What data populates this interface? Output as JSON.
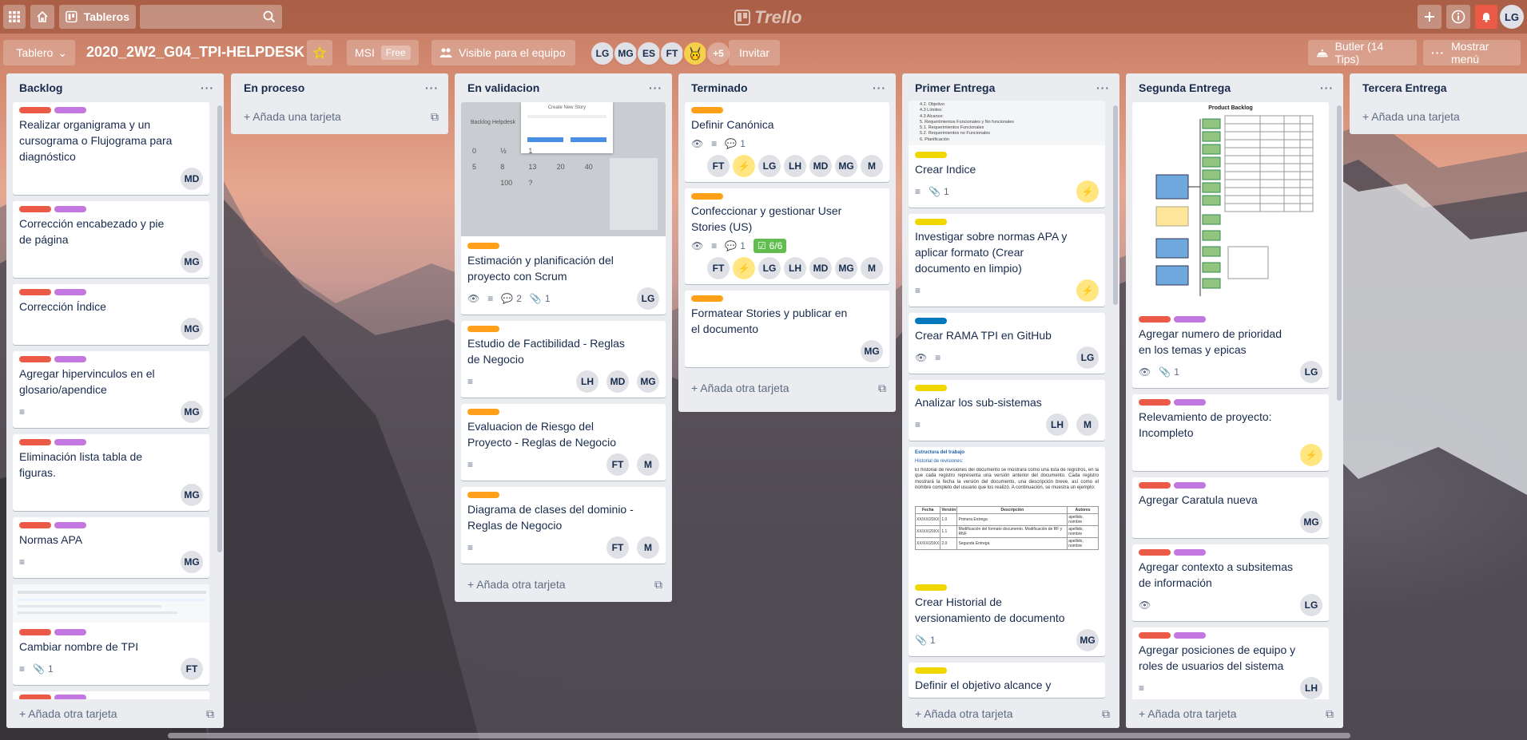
{
  "header": {
    "boards_label": "Tableros",
    "search_placeholder": "",
    "logo_text": "Trello",
    "user_initials": "LG"
  },
  "board": {
    "view_label": "Tablero",
    "title": "2020_2W2_G04_TPI-HELPDESK",
    "team": "MSI",
    "team_plan": "Free",
    "visibility": "Visible para el equipo",
    "members": [
      "LG",
      "MG",
      "ES",
      "FT"
    ],
    "more_members": "+5",
    "invite_label": "Invitar",
    "butler_label": "Butler (14 Tips)",
    "menu_label": "Mostrar menú"
  },
  "lists": [
    {
      "name": "Backlog",
      "add_label": "Añada otra tarjeta",
      "cards": [
        {
          "title": "Realizar organigrama y un cursograma o Flujograma para diagnóstico",
          "member": "MD"
        },
        {
          "title": "Corrección encabezado y pie de página",
          "member": "MG"
        },
        {
          "title": "Corrección Índice",
          "member": "MG"
        },
        {
          "title": "Agregar hipervinculos en el glosario/apendice",
          "member": "MG"
        },
        {
          "title": "Eliminación lista tabla de figuras.",
          "member": "MG"
        },
        {
          "title": "Normas APA",
          "member": "MG"
        },
        {
          "title": "Cambiar nombre de TPI",
          "member": "FT",
          "attachments": "1"
        }
      ]
    },
    {
      "name": "En proceso",
      "add_label": "Añada una tarjeta"
    },
    {
      "name": "En validacion",
      "add_label": "Añada otra tarjeta",
      "cover_title": "Create New Story",
      "cover_heading": "Backlog Helpdesk",
      "cover_numbers": [
        "0",
        "½",
        "1",
        "5",
        "8",
        "13",
        "20",
        "40",
        "100",
        "?"
      ],
      "cards": [
        {
          "title": "Estimación y planificación del proyecto con Scrum",
          "comments": "2",
          "attachments": "1",
          "members": [
            "LG"
          ]
        },
        {
          "title": "Estudio de Factibilidad - Reglas de Negocio",
          "members": [
            "LH",
            "MD",
            "MG"
          ]
        },
        {
          "title": "Evaluacion de Riesgo del Proyecto - Reglas de Negocio",
          "members": [
            "FT",
            "M"
          ]
        },
        {
          "title": "Diagrama de clases del dominio - Reglas de Negocio",
          "members": [
            "FT",
            "M"
          ]
        }
      ]
    },
    {
      "name": "Terminado",
      "add_label": "Añada otra tarjeta",
      "cards": [
        {
          "title": "Definir Canónica",
          "comments": "1",
          "members": [
            "FT",
            "LG",
            "LH",
            "MD",
            "MG",
            "M"
          ]
        },
        {
          "title": "Confeccionar y gestionar User Stories (US)",
          "comments": "1",
          "checklist": "6/6",
          "members": [
            "FT",
            "LG",
            "LH",
            "MD",
            "MG",
            "M"
          ]
        },
        {
          "title": "Formatear Stories y publicar en el documento",
          "members": [
            "MG"
          ]
        }
      ]
    },
    {
      "name": "Primer Entrega",
      "add_label": "Añada otra tarjeta",
      "cover_toc": [
        "4.2. Objetivo",
        "4.3 Límites:",
        "4.3 Alcance:",
        "5. Requerimientos Funcionales y No funcionales",
        "5.1. Requerimientos Funcionales",
        "5.2. Requerimientos no Funcionales",
        "6. Planificación"
      ],
      "doc_heading": "Estructura del trabajo",
      "doc_sub": "Historial de revisiones:",
      "doc_para": "El historial de revisiones del documento se mostrará como una lista de registros, en la que cada registro representa una versión anterior del documento. Cada registro mostrará la fecha la versión del documento, una descripción breve, así como el nombre completo del usuario que los realizó. A continuación, se muestra un ejemplo:",
      "doc_table_head": [
        "Fecha",
        "Versión",
        "Descripción",
        "Autores"
      ],
      "doc_table_rows": [
        [
          "XX/XX/20XX",
          "1.0",
          "Primera Entrega",
          "apellido, nombre"
        ],
        [
          "XX/XX/20XX",
          "1.1",
          "Modificación del formato documento. Modificación de RF y RNF.",
          "apellido, nombre"
        ],
        [
          "XX/XX/20XX",
          "2.0",
          "Segunda Entrega",
          "apellido, nombre"
        ]
      ],
      "cards": [
        {
          "title": "Crear Indice",
          "attachments": "1"
        },
        {
          "title": "Investigar sobre normas APA y aplicar formato (Crear documento en limpio)"
        },
        {
          "title": "Crear RAMA TPI en GitHub",
          "members": [
            "LG"
          ]
        },
        {
          "title": "Analizar los sub-sistemas",
          "members": [
            "LH",
            "M"
          ]
        },
        {
          "title": "Crear Historial de versionamiento de documento",
          "attachments": "1",
          "members": [
            "MG"
          ]
        },
        {
          "title": "Definir el objetivo alcance y"
        }
      ]
    },
    {
      "name": "Segunda Entrega",
      "add_label": "Añada otra tarjeta",
      "cover_title": "Product Backlog",
      "cards": [
        {
          "title": "Agregar numero de prioridad en los temas y epicas",
          "attachments": "1",
          "members": [
            "LG"
          ]
        },
        {
          "title": "Relevamiento de proyecto: Incompleto"
        },
        {
          "title": "Agregar Caratula nueva",
          "members": [
            "MG"
          ]
        },
        {
          "title": "Agregar contexto a subsitemas de información",
          "members": [
            "LG"
          ]
        },
        {
          "title": "Agregar posiciones de equipo y roles de usuarios del sistema",
          "members": [
            "LH"
          ]
        }
      ]
    },
    {
      "name": "Tercera Entrega",
      "add_label": "Añada una tarjeta"
    }
  ]
}
